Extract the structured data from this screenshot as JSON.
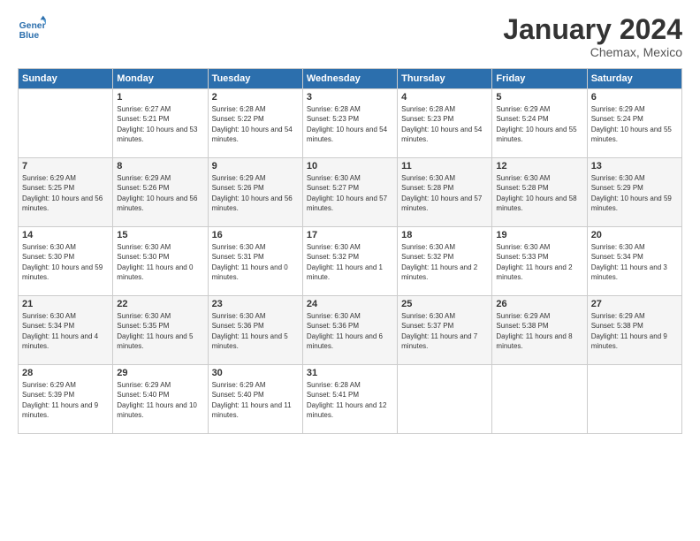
{
  "logo": {
    "text_general": "General",
    "text_blue": "Blue"
  },
  "header": {
    "month": "January 2024",
    "location": "Chemax, Mexico"
  },
  "days_of_week": [
    "Sunday",
    "Monday",
    "Tuesday",
    "Wednesday",
    "Thursday",
    "Friday",
    "Saturday"
  ],
  "weeks": [
    [
      {
        "day": "",
        "sunrise": "",
        "sunset": "",
        "daylight": ""
      },
      {
        "day": "1",
        "sunrise": "Sunrise: 6:27 AM",
        "sunset": "Sunset: 5:21 PM",
        "daylight": "Daylight: 10 hours and 53 minutes."
      },
      {
        "day": "2",
        "sunrise": "Sunrise: 6:28 AM",
        "sunset": "Sunset: 5:22 PM",
        "daylight": "Daylight: 10 hours and 54 minutes."
      },
      {
        "day": "3",
        "sunrise": "Sunrise: 6:28 AM",
        "sunset": "Sunset: 5:23 PM",
        "daylight": "Daylight: 10 hours and 54 minutes."
      },
      {
        "day": "4",
        "sunrise": "Sunrise: 6:28 AM",
        "sunset": "Sunset: 5:23 PM",
        "daylight": "Daylight: 10 hours and 54 minutes."
      },
      {
        "day": "5",
        "sunrise": "Sunrise: 6:29 AM",
        "sunset": "Sunset: 5:24 PM",
        "daylight": "Daylight: 10 hours and 55 minutes."
      },
      {
        "day": "6",
        "sunrise": "Sunrise: 6:29 AM",
        "sunset": "Sunset: 5:24 PM",
        "daylight": "Daylight: 10 hours and 55 minutes."
      }
    ],
    [
      {
        "day": "7",
        "sunrise": "Sunrise: 6:29 AM",
        "sunset": "Sunset: 5:25 PM",
        "daylight": "Daylight: 10 hours and 56 minutes."
      },
      {
        "day": "8",
        "sunrise": "Sunrise: 6:29 AM",
        "sunset": "Sunset: 5:26 PM",
        "daylight": "Daylight: 10 hours and 56 minutes."
      },
      {
        "day": "9",
        "sunrise": "Sunrise: 6:29 AM",
        "sunset": "Sunset: 5:26 PM",
        "daylight": "Daylight: 10 hours and 56 minutes."
      },
      {
        "day": "10",
        "sunrise": "Sunrise: 6:30 AM",
        "sunset": "Sunset: 5:27 PM",
        "daylight": "Daylight: 10 hours and 57 minutes."
      },
      {
        "day": "11",
        "sunrise": "Sunrise: 6:30 AM",
        "sunset": "Sunset: 5:28 PM",
        "daylight": "Daylight: 10 hours and 57 minutes."
      },
      {
        "day": "12",
        "sunrise": "Sunrise: 6:30 AM",
        "sunset": "Sunset: 5:28 PM",
        "daylight": "Daylight: 10 hours and 58 minutes."
      },
      {
        "day": "13",
        "sunrise": "Sunrise: 6:30 AM",
        "sunset": "Sunset: 5:29 PM",
        "daylight": "Daylight: 10 hours and 59 minutes."
      }
    ],
    [
      {
        "day": "14",
        "sunrise": "Sunrise: 6:30 AM",
        "sunset": "Sunset: 5:30 PM",
        "daylight": "Daylight: 10 hours and 59 minutes."
      },
      {
        "day": "15",
        "sunrise": "Sunrise: 6:30 AM",
        "sunset": "Sunset: 5:30 PM",
        "daylight": "Daylight: 11 hours and 0 minutes."
      },
      {
        "day": "16",
        "sunrise": "Sunrise: 6:30 AM",
        "sunset": "Sunset: 5:31 PM",
        "daylight": "Daylight: 11 hours and 0 minutes."
      },
      {
        "day": "17",
        "sunrise": "Sunrise: 6:30 AM",
        "sunset": "Sunset: 5:32 PM",
        "daylight": "Daylight: 11 hours and 1 minute."
      },
      {
        "day": "18",
        "sunrise": "Sunrise: 6:30 AM",
        "sunset": "Sunset: 5:32 PM",
        "daylight": "Daylight: 11 hours and 2 minutes."
      },
      {
        "day": "19",
        "sunrise": "Sunrise: 6:30 AM",
        "sunset": "Sunset: 5:33 PM",
        "daylight": "Daylight: 11 hours and 2 minutes."
      },
      {
        "day": "20",
        "sunrise": "Sunrise: 6:30 AM",
        "sunset": "Sunset: 5:34 PM",
        "daylight": "Daylight: 11 hours and 3 minutes."
      }
    ],
    [
      {
        "day": "21",
        "sunrise": "Sunrise: 6:30 AM",
        "sunset": "Sunset: 5:34 PM",
        "daylight": "Daylight: 11 hours and 4 minutes."
      },
      {
        "day": "22",
        "sunrise": "Sunrise: 6:30 AM",
        "sunset": "Sunset: 5:35 PM",
        "daylight": "Daylight: 11 hours and 5 minutes."
      },
      {
        "day": "23",
        "sunrise": "Sunrise: 6:30 AM",
        "sunset": "Sunset: 5:36 PM",
        "daylight": "Daylight: 11 hours and 5 minutes."
      },
      {
        "day": "24",
        "sunrise": "Sunrise: 6:30 AM",
        "sunset": "Sunset: 5:36 PM",
        "daylight": "Daylight: 11 hours and 6 minutes."
      },
      {
        "day": "25",
        "sunrise": "Sunrise: 6:30 AM",
        "sunset": "Sunset: 5:37 PM",
        "daylight": "Daylight: 11 hours and 7 minutes."
      },
      {
        "day": "26",
        "sunrise": "Sunrise: 6:29 AM",
        "sunset": "Sunset: 5:38 PM",
        "daylight": "Daylight: 11 hours and 8 minutes."
      },
      {
        "day": "27",
        "sunrise": "Sunrise: 6:29 AM",
        "sunset": "Sunset: 5:38 PM",
        "daylight": "Daylight: 11 hours and 9 minutes."
      }
    ],
    [
      {
        "day": "28",
        "sunrise": "Sunrise: 6:29 AM",
        "sunset": "Sunset: 5:39 PM",
        "daylight": "Daylight: 11 hours and 9 minutes."
      },
      {
        "day": "29",
        "sunrise": "Sunrise: 6:29 AM",
        "sunset": "Sunset: 5:40 PM",
        "daylight": "Daylight: 11 hours and 10 minutes."
      },
      {
        "day": "30",
        "sunrise": "Sunrise: 6:29 AM",
        "sunset": "Sunset: 5:40 PM",
        "daylight": "Daylight: 11 hours and 11 minutes."
      },
      {
        "day": "31",
        "sunrise": "Sunrise: 6:28 AM",
        "sunset": "Sunset: 5:41 PM",
        "daylight": "Daylight: 11 hours and 12 minutes."
      },
      {
        "day": "",
        "sunrise": "",
        "sunset": "",
        "daylight": ""
      },
      {
        "day": "",
        "sunrise": "",
        "sunset": "",
        "daylight": ""
      },
      {
        "day": "",
        "sunrise": "",
        "sunset": "",
        "daylight": ""
      }
    ]
  ]
}
